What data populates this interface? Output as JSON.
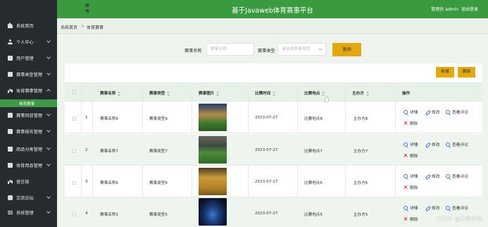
{
  "header": {
    "title": "基于Javaweb体育赛事平台",
    "user_text": "管理员 admin",
    "logout_label": "退出登录"
  },
  "sidebar": {
    "items": [
      {
        "label": "系统首页",
        "icon": "home-icon"
      },
      {
        "label": "个人中心",
        "icon": "user-icon"
      },
      {
        "label": "用户管理",
        "icon": "box-icon"
      },
      {
        "label": "赛事类型管理",
        "icon": "box-icon"
      },
      {
        "label": "体育赛事管理",
        "icon": "bar-chart-icon"
      },
      {
        "label": "赛事回放管理",
        "icon": "box-icon"
      },
      {
        "label": "赛事报名管理",
        "icon": "box-icon"
      },
      {
        "label": "商品分类管理",
        "icon": "box-icon"
      },
      {
        "label": "体育用品管理",
        "icon": "box-icon"
      },
      {
        "label": "留言板",
        "icon": "bar-chart-icon"
      },
      {
        "label": "交流论坛",
        "icon": "chat-icon"
      },
      {
        "label": "系统管理",
        "icon": "list-icon"
      }
    ],
    "active_sub": "体育赛事",
    "accent_color": "#3f9a45"
  },
  "breadcrumb": {
    "home": "系统首页",
    "separator": ">",
    "current": "体育赛事"
  },
  "search": {
    "name_label": "赛事名称",
    "name_placeholder": "赛事名称",
    "type_label": "赛事类型",
    "type_placeholder": "请选择赛事类型",
    "button": "查询"
  },
  "toolbar": {
    "add": "新增",
    "delete": "删除"
  },
  "table": {
    "headers": {
      "seq": "序号",
      "name": "赛事名称",
      "type": "赛事类型",
      "image": "赛事图片",
      "time": "比赛时间",
      "place": "比赛地点",
      "host": "主办方",
      "ops": "操作"
    },
    "ops": {
      "detail": "详情",
      "edit": "修改",
      "review": "查看评论",
      "remove": "删除"
    },
    "rows": [
      {
        "seq": "1",
        "name": "赛事名称8",
        "type": "赛事类型8",
        "time": "2023-07-27",
        "place": "比赛地点8",
        "host": "主办方8"
      },
      {
        "seq": "2",
        "name": "赛事名称7",
        "type": "赛事类型7",
        "time": "2023-07-27",
        "place": "比赛地点7",
        "host": "主办方7"
      },
      {
        "seq": "3",
        "name": "赛事名称6",
        "type": "赛事类型6",
        "time": "2023-07-27",
        "place": "比赛地点6",
        "host": "主办方6"
      },
      {
        "seq": "4",
        "name": "赛事名称5",
        "type": "赛事类型5",
        "time": "2023-07-27",
        "place": "比赛地点5",
        "host": "主办方5"
      }
    ]
  },
  "watermark": "CSDN @辛雨学姐",
  "colors": {
    "header": "#3a9a3f",
    "button": "#e3a70f",
    "sidebar": "#262b30",
    "link": "#3b7bd4",
    "danger": "#d33333"
  }
}
